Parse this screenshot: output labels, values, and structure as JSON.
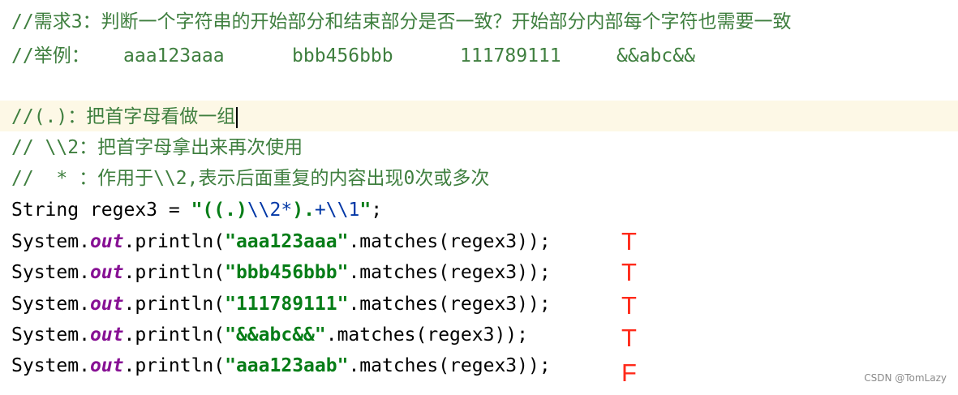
{
  "colors": {
    "comment": "#3f7f3f",
    "string": "#067d17",
    "escape": "#0037a6",
    "field": "#871094",
    "plain": "#000000",
    "current_line": "#fdf8e6",
    "annotation": "#ff2a1a"
  },
  "comments": {
    "requirement": "//需求3：判断一个字符串的开始部分和结束部分是否一致？开始部分内部每个字符也需要一致",
    "example_label": "//举例：",
    "examples": [
      "aaa123aaa",
      "bbb456bbb",
      "111789111",
      "&&abc&&"
    ],
    "group": "//(.)：把首字母看做一组",
    "backref": "// \\\\2：把首字母拿出来再次使用",
    "star": "//  * ：作用于\\\\2,表示后面重复的内容出现0次或多次"
  },
  "code": {
    "decl_prefix": "String regex3 = ",
    "regex_open": "\"((.)",
    "regex_esc1": "\\\\2",
    "regex_star": "*",
    "regex_mid": ").",
    "regex_plus": "+",
    "regex_esc2": "\\\\1",
    "regex_close": "\"",
    "decl_suffix": ";",
    "println_prefix": "System.",
    "out_field": "out",
    "println_call": ".println(",
    "matches_suffix": ".matches(regex3));",
    "calls": [
      {
        "arg": "\"aaa123aaa\"",
        "result": "T"
      },
      {
        "arg": "\"bbb456bbb\"",
        "result": "T"
      },
      {
        "arg": "\"111789111\"",
        "result": "T"
      },
      {
        "arg": "\"&&abc&&\"",
        "result": "T"
      },
      {
        "arg": "\"aaa123aab\"",
        "result": "F"
      }
    ]
  },
  "watermark": "CSDN @TomLazy"
}
